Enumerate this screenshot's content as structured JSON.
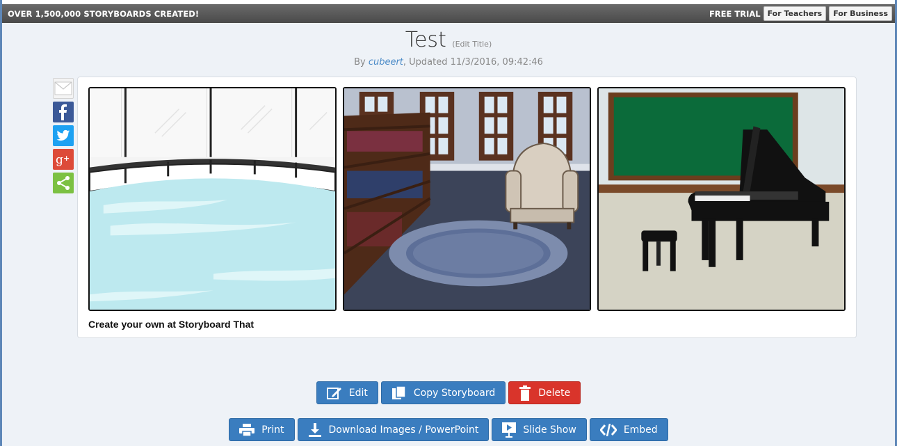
{
  "banner": {
    "promo": "OVER 1,500,000 STORYBOARDS CREATED!",
    "trial": "FREE TRIAL",
    "teachers": "For Teachers",
    "business": "For Business"
  },
  "storyboard": {
    "title": "Test",
    "edit_title": "(Edit Title)",
    "by_prefix": "By ",
    "author": "cubeert",
    "updated": ", Updated 11/3/2016, 09:42:46",
    "credit": "Create your own at Storyboard That",
    "cells": [
      "ice-rink-scene",
      "library-scene",
      "music-room-scene"
    ]
  },
  "social": [
    "mail-icon",
    "facebook-icon",
    "twitter-icon",
    "google-plus-icon",
    "share-icon"
  ],
  "actions": {
    "edit": "Edit",
    "copy": "Copy Storyboard",
    "delete": "Delete",
    "print": "Print",
    "download": "Download Images / PowerPoint",
    "slideshow": "Slide Show",
    "embed": "Embed"
  },
  "colors": {
    "primary_button": "#3a7dbf",
    "danger_button": "#d9342b",
    "banner": "#5a5a5a",
    "author_link": "#4a8ac7"
  }
}
